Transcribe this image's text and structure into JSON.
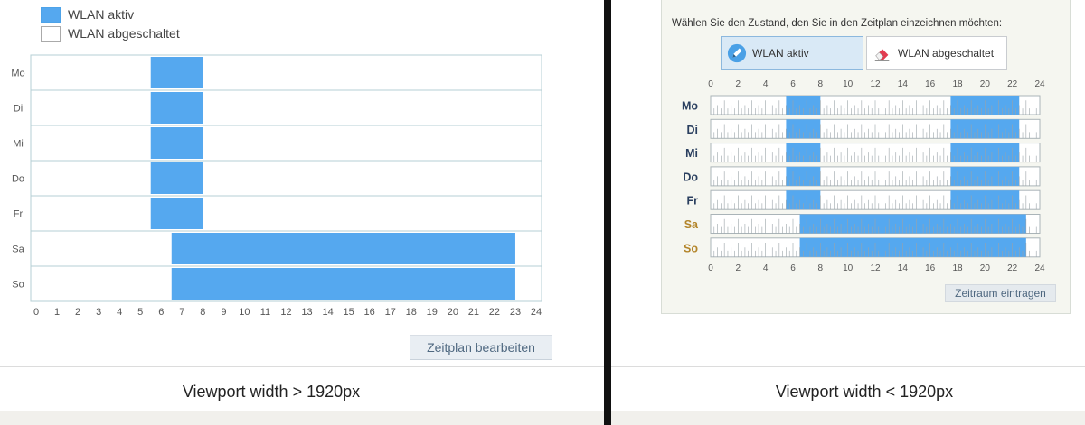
{
  "colors": {
    "active": "#55a8ef",
    "grid": "#b5cfd4",
    "weekend_label": "#b3852a",
    "weekday_label": "#2a3f5f"
  },
  "left": {
    "legend": {
      "active_label": "WLAN aktiv",
      "off_label": "WLAN abgeschaltet"
    },
    "button_label": "Zeitplan bearbeiten",
    "caption": "Viewport width > 1920px"
  },
  "right": {
    "prompt": "Wählen Sie den Zustand, den Sie in den Zeitplan einzeichnen möchten:",
    "state_active_label": "WLAN aktiv",
    "state_off_label": "WLAN abgeschaltet",
    "state_active_icon": "pencil-icon",
    "state_off_icon": "eraser-icon",
    "button_label": "Zeitraum eintragen",
    "caption": "Viewport width < 1920px"
  },
  "chart_data": [
    {
      "type": "schedule",
      "view": "bars",
      "days": [
        "Mo",
        "Di",
        "Mi",
        "Do",
        "Fr",
        "Sa",
        "So"
      ],
      "x_ticks": [
        "0",
        "1",
        "2",
        "3",
        "4",
        "5",
        "6",
        "7",
        "8",
        "9",
        "10",
        "11",
        "12",
        "13",
        "14",
        "15",
        "16",
        "17",
        "18",
        "19",
        "20",
        "21",
        "22",
        "23",
        "24"
      ],
      "xlim": [
        0,
        24
      ],
      "series": [
        {
          "name": "WLAN aktiv",
          "intervals": {
            "Mo": [
              [
                5.5,
                8
              ]
            ],
            "Di": [
              [
                5.5,
                8
              ]
            ],
            "Mi": [
              [
                5.5,
                8
              ]
            ],
            "Do": [
              [
                5.5,
                8
              ]
            ],
            "Fr": [
              [
                5.5,
                8
              ]
            ],
            "Sa": [
              [
                6.5,
                23
              ]
            ],
            "So": [
              [
                6.5,
                23
              ]
            ]
          }
        }
      ]
    },
    {
      "type": "schedule",
      "view": "grid",
      "days": [
        "Mo",
        "Di",
        "Mi",
        "Do",
        "Fr",
        "Sa",
        "So"
      ],
      "weekend": [
        "Sa",
        "So"
      ],
      "x_ticks": [
        "0",
        "2",
        "4",
        "6",
        "8",
        "10",
        "12",
        "14",
        "16",
        "18",
        "20",
        "22",
        "24"
      ],
      "xlim": [
        0,
        24
      ],
      "series": [
        {
          "name": "WLAN aktiv",
          "intervals": {
            "Mo": [
              [
                5.5,
                8
              ],
              [
                17.5,
                22.5
              ]
            ],
            "Di": [
              [
                5.5,
                8
              ],
              [
                17.5,
                22.5
              ]
            ],
            "Mi": [
              [
                5.5,
                8
              ],
              [
                17.5,
                22.5
              ]
            ],
            "Do": [
              [
                5.5,
                8
              ],
              [
                17.5,
                22.5
              ]
            ],
            "Fr": [
              [
                5.5,
                8
              ],
              [
                17.5,
                22.5
              ]
            ],
            "Sa": [
              [
                6.5,
                23
              ]
            ],
            "So": [
              [
                6.5,
                23
              ]
            ]
          }
        }
      ]
    }
  ]
}
